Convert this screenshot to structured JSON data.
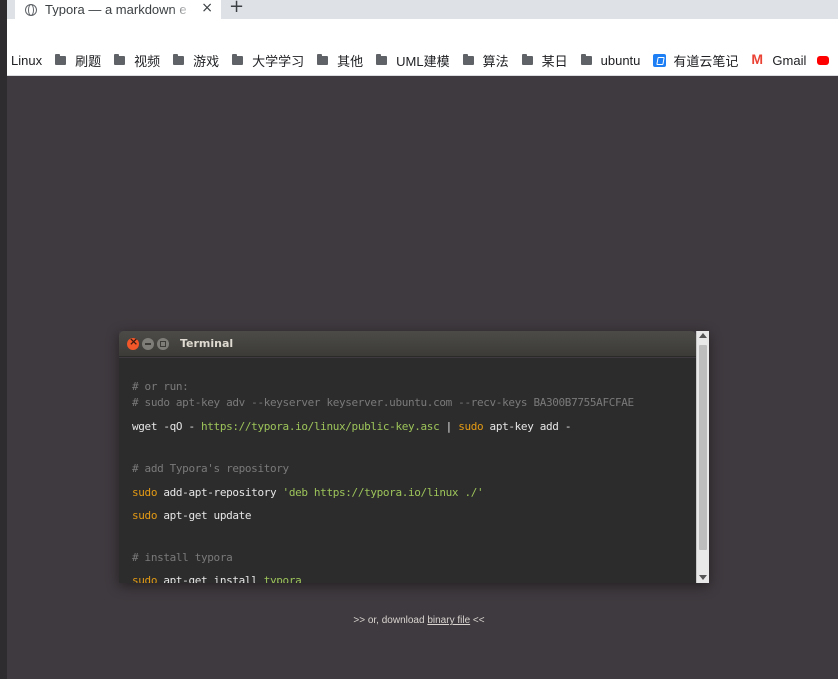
{
  "browser": {
    "tab_title": "Typora — a markdown e",
    "tab_close": "×",
    "new_tab": "+"
  },
  "bookmarks": [
    {
      "label": "Linux",
      "icon": "none"
    },
    {
      "label": "刷题",
      "icon": "folder-icon"
    },
    {
      "label": "视频",
      "icon": "folder-icon"
    },
    {
      "label": "游戏",
      "icon": "folder-icon"
    },
    {
      "label": "大学学习",
      "icon": "folder-icon"
    },
    {
      "label": "其他",
      "icon": "folder-icon"
    },
    {
      "label": "UML建模",
      "icon": "folder-icon"
    },
    {
      "label": "算法",
      "icon": "folder-icon"
    },
    {
      "label": "某日",
      "icon": "folder-icon"
    },
    {
      "label": "ubuntu",
      "icon": "folder-icon"
    },
    {
      "label": "有道云笔记",
      "icon": "youdao-icon"
    },
    {
      "label": "Gmail",
      "icon": "gmail-icon"
    }
  ],
  "terminal": {
    "title": "Terminal",
    "lines": {
      "c1": "# or run:",
      "c2": "# sudo apt-key adv --keyserver keyserver.ubuntu.com --recv-keys BA300B7755AFCFAE",
      "l3a": "wget -qO - ",
      "l3b": "https://typora.io/linux/public-key.asc",
      "l3c": " | ",
      "l3d": "sudo",
      "l3e": " apt-key add -",
      "c4": "# add Typora's repository",
      "l5a": "sudo",
      "l5b": " add-apt-repository ",
      "l5c": "'deb https://typora.io/linux ./'",
      "l6a": "sudo",
      "l6b": " apt-get update",
      "c7": "# install typora",
      "l8a": "sudo",
      "l8b": " apt-get install ",
      "l8c": "typora"
    }
  },
  "download": {
    "prefix": ">> or, download ",
    "link": "binary file",
    "suffix": " <<"
  },
  "colors": {
    "page_bg": "#3f3a3f",
    "terminal_bg": "#2c2c2c",
    "keyword": "#e39a14",
    "string": "#9dc45a",
    "comment": "#7a7a7a"
  }
}
